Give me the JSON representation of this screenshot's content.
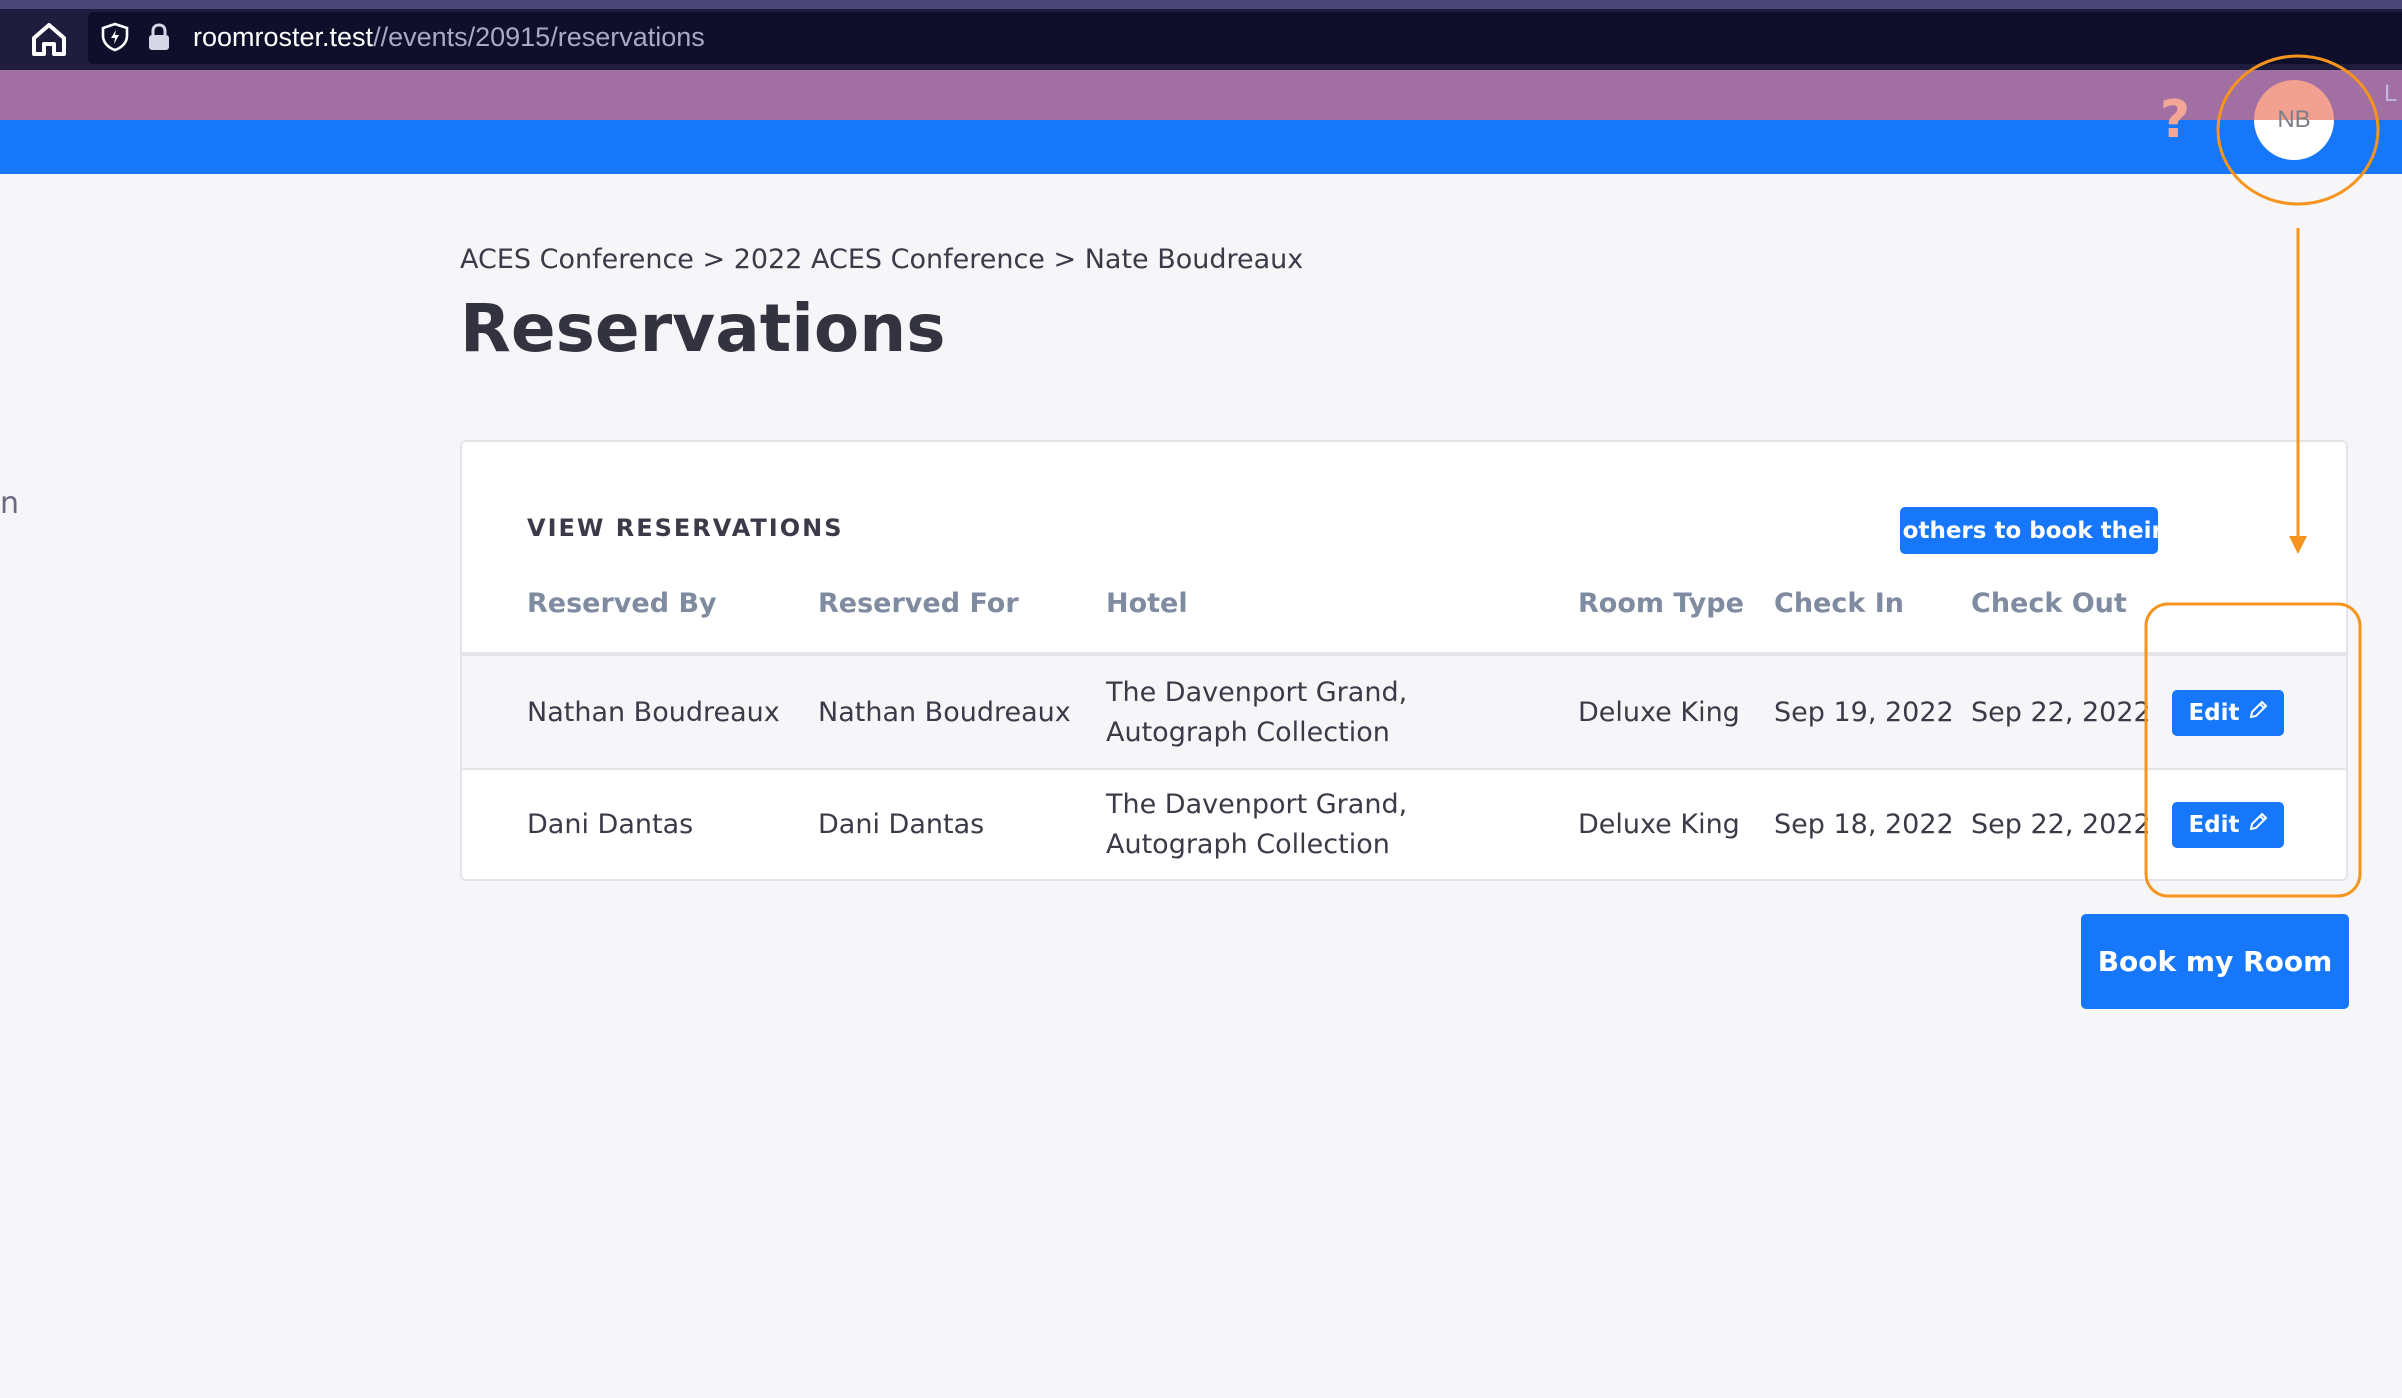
{
  "browser": {
    "url_host": "roomroster.test",
    "url_path": "//events/20915/reservations",
    "home_icon": "home-icon",
    "shield_icon": "shield-icon",
    "lock_icon": "lock-icon"
  },
  "header": {
    "help_label": "?",
    "avatar_initials": "NB",
    "logout_fragment": "L",
    "purple": "#a26fa2",
    "blue": "#1677fb"
  },
  "sidebar_fragment": "n",
  "breadcrumb": "ACES Conference > 2022 ACES Conference > Nate Boudreaux",
  "page_title": "Reservations",
  "card": {
    "heading": "VIEW RESERVATIONS",
    "invite_label": "Invite others to book their room",
    "columns": [
      "Reserved By",
      "Reserved For",
      "Hotel",
      "Room Type",
      "Check In",
      "Check Out"
    ],
    "rows": [
      {
        "reserved_by": "Nathan Boudreaux",
        "reserved_for": "Nathan Boudreaux",
        "hotel": "The Davenport Grand, Autograph Collection",
        "room_type": "Deluxe King",
        "check_in": "Sep 19, 2022",
        "check_out": "Sep 22, 2022",
        "action": "Edit"
      },
      {
        "reserved_by": "Dani Dantas",
        "reserved_for": "Dani Dantas",
        "hotel": "The Davenport Grand, Autograph Collection",
        "room_type": "Deluxe King",
        "check_in": "Sep 18, 2022",
        "check_out": "Sep 22, 2022",
        "action": "Edit"
      }
    ]
  },
  "book_label": "Book my Room",
  "annotation_color": "#f7941d"
}
